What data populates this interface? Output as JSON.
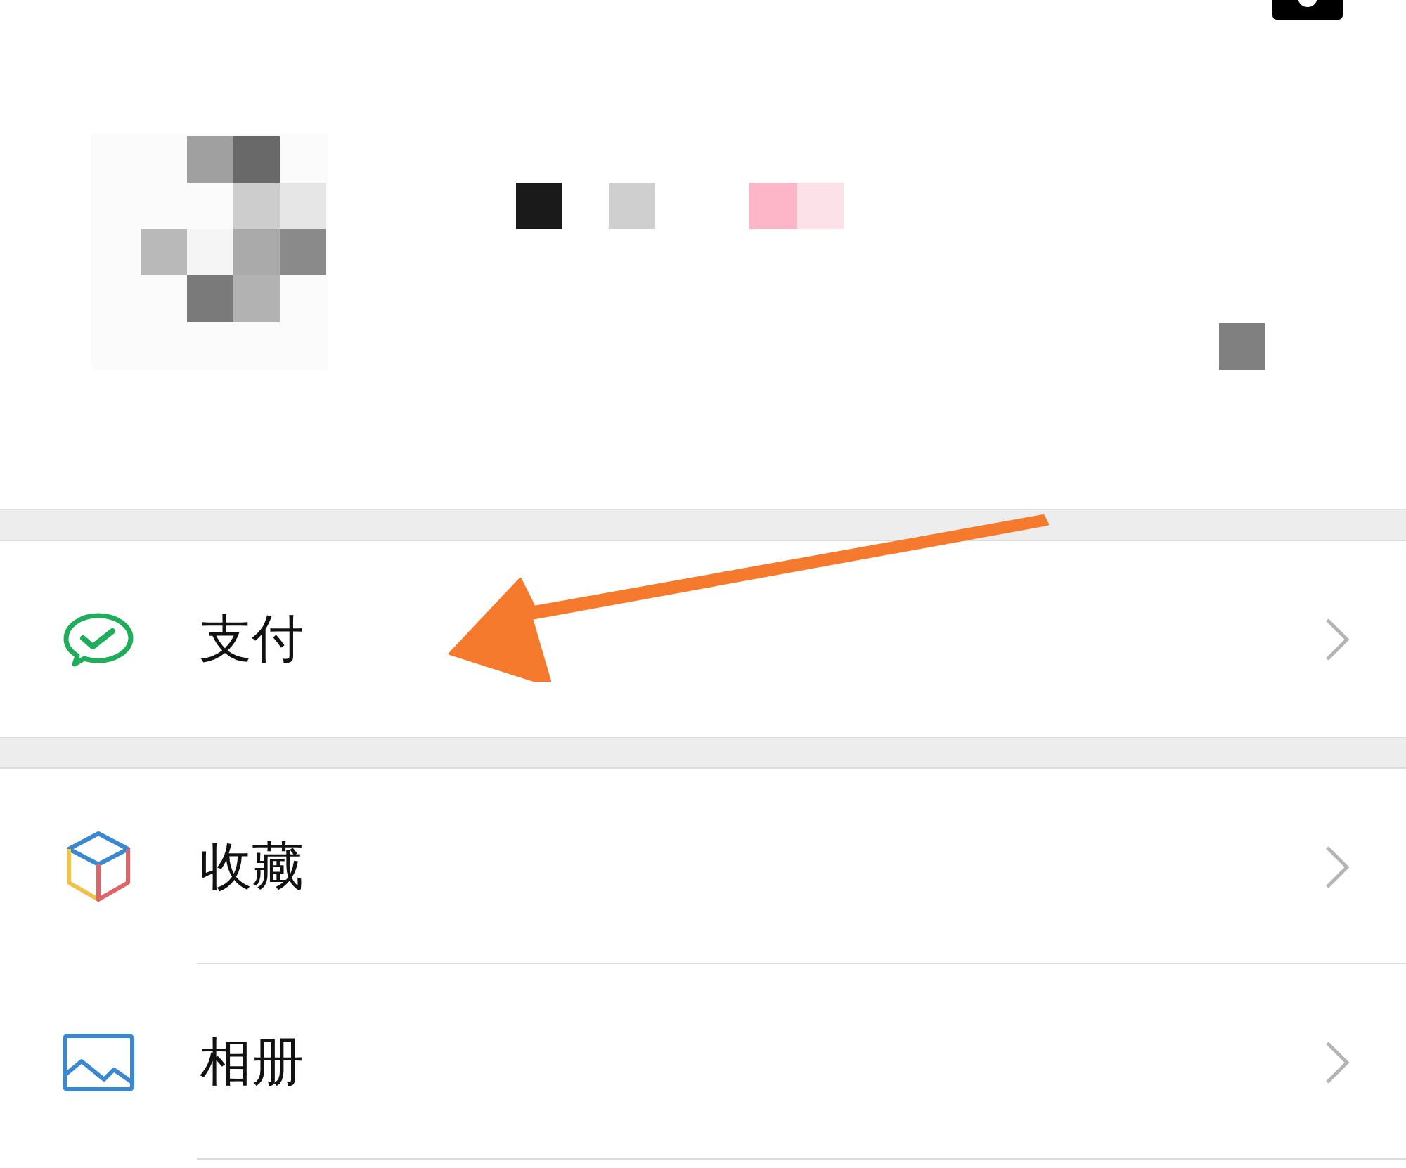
{
  "sections": [
    {
      "items": [
        {
          "kind": "pay",
          "label": "支付"
        }
      ]
    },
    {
      "items": [
        {
          "kind": "favorites",
          "label": "收藏"
        },
        {
          "kind": "album",
          "label": "相册"
        }
      ]
    }
  ]
}
